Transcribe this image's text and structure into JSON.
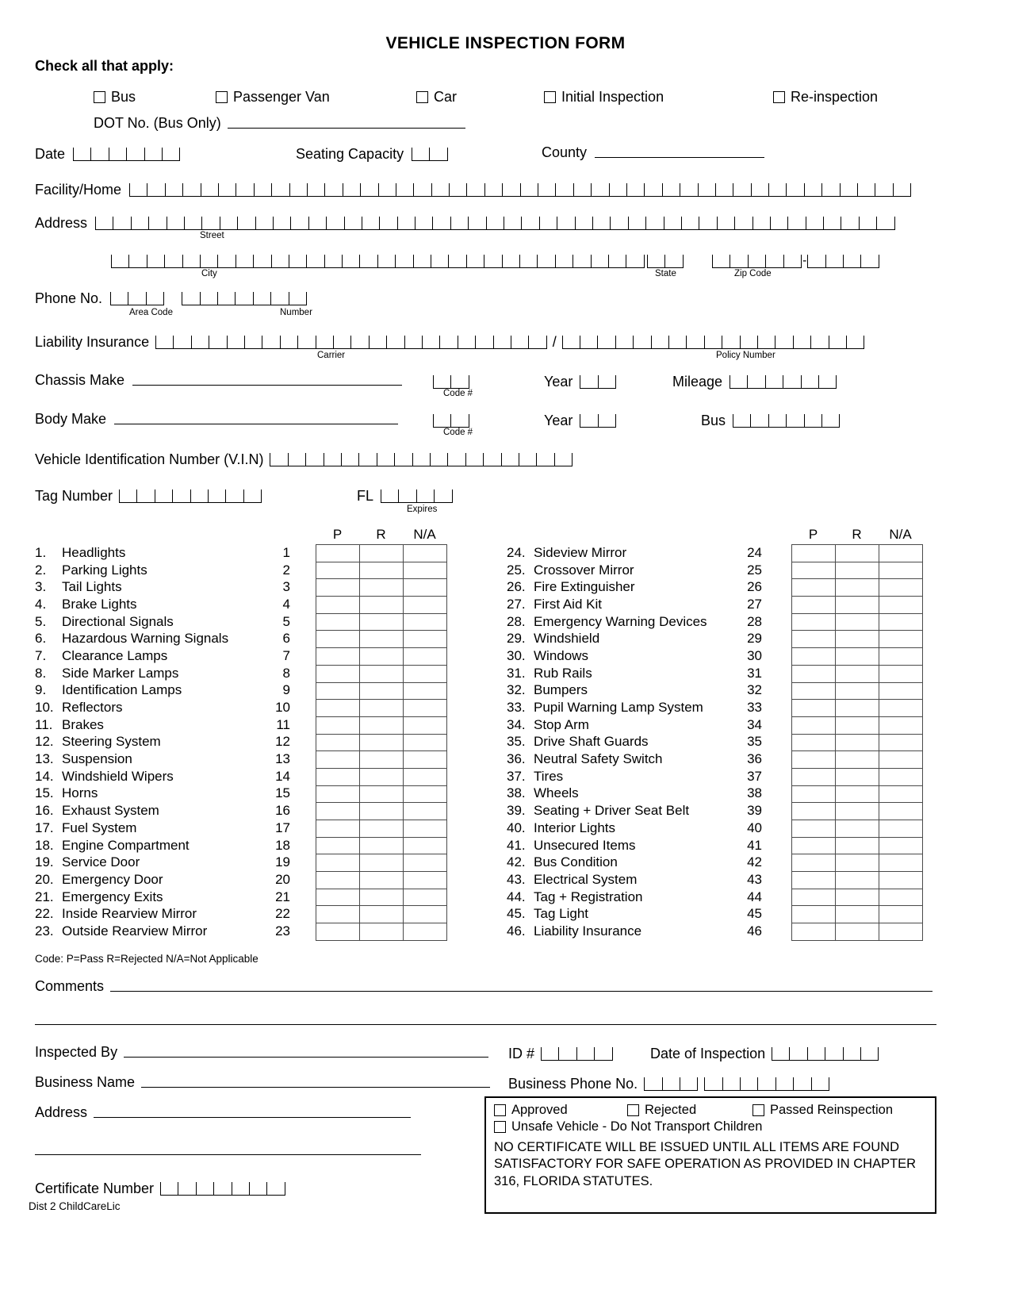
{
  "header": {
    "title": "VEHICLE INSPECTION FORM",
    "check_all_label": "Check all that apply:"
  },
  "vehicle_type": {
    "options": [
      "Bus",
      "Passenger Van",
      "Car",
      "Initial Inspection",
      "Re-inspection"
    ],
    "dot_label": "DOT No. (Bus Only)"
  },
  "identity": {
    "date_label": "Date",
    "seating_capacity_label": "Seating Capacity",
    "county_label": "County",
    "facility_label": "Facility/Home",
    "address_label": "Address",
    "street_sub": "Street",
    "city_sub": "City",
    "state_sub": "State",
    "zip_sub": "Zip Code",
    "phone_label": "Phone No.",
    "area_code_sub": "Area Code",
    "number_sub": "Number",
    "liability_label": "Liability Insurance",
    "carrier_sub": "Carrier",
    "policy_sub": "Policy Number",
    "slash": "/"
  },
  "vehicle": {
    "chassis_make_label": "Chassis Make",
    "body_make_label": "Body Make",
    "code_sub": "Code #",
    "year_label": "Year",
    "mileage_label": "Mileage",
    "bus_label": "Bus",
    "vin_label": "Vehicle Identification Number (V.I.N)",
    "tag_label": "Tag Number",
    "fl_label": "FL",
    "expires_sub": "Expires"
  },
  "checklist": {
    "columns": [
      "P",
      "R",
      "N/A"
    ],
    "code_note": "Code:  P=Pass  R=Rejected  N/A=Not Applicable",
    "left_items": [
      {
        "n": "1.",
        "name": "Headlights",
        "num": "1"
      },
      {
        "n": "2.",
        "name": "Parking Lights",
        "num": "2"
      },
      {
        "n": "3.",
        "name": "Tail Lights",
        "num": "3"
      },
      {
        "n": "4.",
        "name": "Brake Lights",
        "num": "4"
      },
      {
        "n": "5.",
        "name": "Directional Signals",
        "num": "5"
      },
      {
        "n": "6.",
        "name": "Hazardous Warning Signals",
        "num": "6"
      },
      {
        "n": "7.",
        "name": "Clearance Lamps",
        "num": "7"
      },
      {
        "n": "8.",
        "name": "Side Marker Lamps",
        "num": "8"
      },
      {
        "n": "9.",
        "name": "Identification Lamps",
        "num": "9"
      },
      {
        "n": "10.",
        "name": "Reflectors",
        "num": "10"
      },
      {
        "n": "11.",
        "name": "Brakes",
        "num": "11"
      },
      {
        "n": "12.",
        "name": "Steering System",
        "num": "12"
      },
      {
        "n": "13.",
        "name": "Suspension",
        "num": "13"
      },
      {
        "n": "14.",
        "name": "Windshield Wipers",
        "num": "14"
      },
      {
        "n": "15.",
        "name": "Horns",
        "num": "15"
      },
      {
        "n": "16.",
        "name": "Exhaust System",
        "num": "16"
      },
      {
        "n": "17.",
        "name": "Fuel System",
        "num": "17"
      },
      {
        "n": "18.",
        "name": "Engine Compartment",
        "num": "18"
      },
      {
        "n": "19.",
        "name": "Service Door",
        "num": "19"
      },
      {
        "n": "20.",
        "name": "Emergency Door",
        "num": "20"
      },
      {
        "n": "21.",
        "name": "Emergency Exits",
        "num": "21"
      },
      {
        "n": "22.",
        "name": "Inside Rearview Mirror",
        "num": "22"
      },
      {
        "n": "23.",
        "name": "Outside Rearview Mirror",
        "num": "23"
      }
    ],
    "right_items": [
      {
        "n": "24.",
        "name": "Sideview Mirror",
        "num": "24"
      },
      {
        "n": "25.",
        "name": "Crossover Mirror",
        "num": "25"
      },
      {
        "n": "26.",
        "name": "Fire Extinguisher",
        "num": "26"
      },
      {
        "n": "27.",
        "name": "First Aid Kit",
        "num": "27"
      },
      {
        "n": "28.",
        "name": "Emergency Warning Devices",
        "num": "28"
      },
      {
        "n": "29.",
        "name": "Windshield",
        "num": "29"
      },
      {
        "n": "30.",
        "name": "Windows",
        "num": "30"
      },
      {
        "n": "31.",
        "name": "Rub Rails",
        "num": "31"
      },
      {
        "n": "32.",
        "name": "Bumpers",
        "num": "32"
      },
      {
        "n": "33.",
        "name": "Pupil Warning Lamp System",
        "num": "33"
      },
      {
        "n": "34.",
        "name": "Stop Arm",
        "num": "34"
      },
      {
        "n": "35.",
        "name": "Drive Shaft Guards",
        "num": "35"
      },
      {
        "n": "36.",
        "name": "Neutral Safety Switch",
        "num": "36"
      },
      {
        "n": "37.",
        "name": "Tires",
        "num": "37"
      },
      {
        "n": "38.",
        "name": "Wheels",
        "num": "38"
      },
      {
        "n": "39.",
        "name": "Seating + Driver Seat Belt",
        "num": "39"
      },
      {
        "n": "40.",
        "name": "Interior Lights",
        "num": "40"
      },
      {
        "n": "41.",
        "name": "Unsecured Items",
        "num": "41"
      },
      {
        "n": "42.",
        "name": "Bus Condition",
        "num": "42"
      },
      {
        "n": "43.",
        "name": "Electrical System",
        "num": "43"
      },
      {
        "n": "44.",
        "name": "Tag + Registration",
        "num": "44"
      },
      {
        "n": "45.",
        "name": "Tag Light",
        "num": "45"
      },
      {
        "n": "46.",
        "name": "Liability Insurance",
        "num": "46"
      }
    ]
  },
  "footer": {
    "comments_label": "Comments",
    "inspected_by_label": "Inspected By",
    "id_label": "ID #",
    "date_of_inspection_label": "Date of Inspection",
    "business_name_label": "Business Name",
    "business_phone_label": "Business Phone No.",
    "address_label": "Address",
    "certificate_label": "Certificate Number",
    "dist_note": "Dist 2 ChildCareLic"
  },
  "decision": {
    "options": [
      "Approved",
      "Rejected",
      "Passed Reinspection"
    ],
    "unsafe_option": "Unsafe Vehicle - Do Not Transport Children",
    "statement_lines": [
      "NO CERTIFICATE WILL BE ISSUED UNTIL ALL ITEMS ARE FOUND",
      "SATISFACTORY FOR SAFE OPERATION AS PROVIDED IN CHAPTER",
      "316, FLORIDA STATUTES."
    ]
  }
}
